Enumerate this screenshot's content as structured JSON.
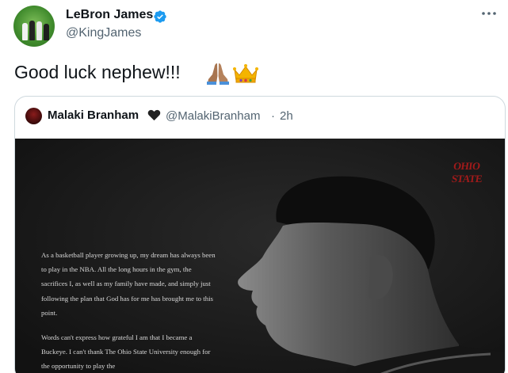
{
  "author": {
    "name": "LeBron James",
    "handle": "@KingJames"
  },
  "tweet": {
    "text": "Good luck nephew!!!",
    "emojis": [
      "pray-icon",
      "crown-icon"
    ]
  },
  "menu": {
    "more_icon": "more-horizontal-icon"
  },
  "quoted": {
    "name": "Malaki Branham",
    "name_emoji": "black-heart-icon",
    "handle": "@MalakiBranham",
    "separator": "·",
    "time": "2h",
    "media": {
      "logo_text": "OHIO STATE",
      "paragraph1": "As a basketball player growing up, my dream has always been to play in the NBA. All the long hours in the gym, the sacrifices I, as well as my family have made, and simply just following the plan that God has for me has brought me to this point.",
      "paragraph2": "Words can't express how grateful I am that I became a Buckeye. I can't thank The Ohio State University enough for the opportunity to play the"
    }
  },
  "colors": {
    "verified": "#1d9bf0",
    "secondary_text": "#536471",
    "border": "#cfd9de",
    "osu_red": "#a11a1a"
  }
}
